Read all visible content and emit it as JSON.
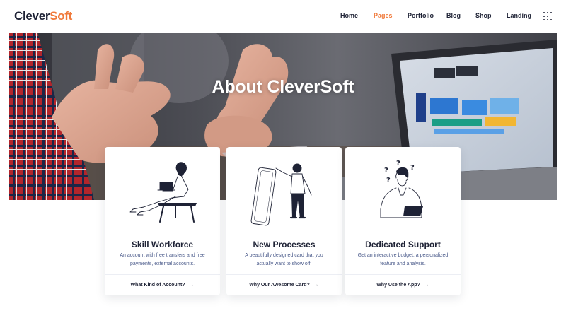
{
  "brand": {
    "name_main": "Clever",
    "name_accent": "Soft"
  },
  "nav": {
    "items": [
      {
        "label": "Home",
        "active": false
      },
      {
        "label": "Pages",
        "active": true
      },
      {
        "label": "Portfolio",
        "active": false
      },
      {
        "label": "Blog",
        "active": false
      },
      {
        "label": "Shop",
        "active": false
      },
      {
        "label": "Landing",
        "active": false
      }
    ],
    "menu_icon": "grid-dots-icon"
  },
  "hero": {
    "title": "About CleverSoft"
  },
  "cards": [
    {
      "title": "Skill Workforce",
      "description": "An account with free transfers and free payments, external accounts.",
      "link_label": "What Kind of Account?",
      "link_icon": "arrow-right-icon"
    },
    {
      "title": "New Processes",
      "description": "A beautifully designed card that you actually want to show off.",
      "link_label": "Why Our Awesome Card?",
      "link_icon": "arrow-right-icon"
    },
    {
      "title": "Dedicated Support",
      "description": "Get an interactive budget, a personalized feature and analysis.",
      "link_label": "Why Use the App?",
      "link_icon": "arrow-right-icon"
    }
  ],
  "colors": {
    "accent": "#f0793a",
    "text_dark": "#1e2235",
    "text_muted": "#4a5a8a"
  }
}
